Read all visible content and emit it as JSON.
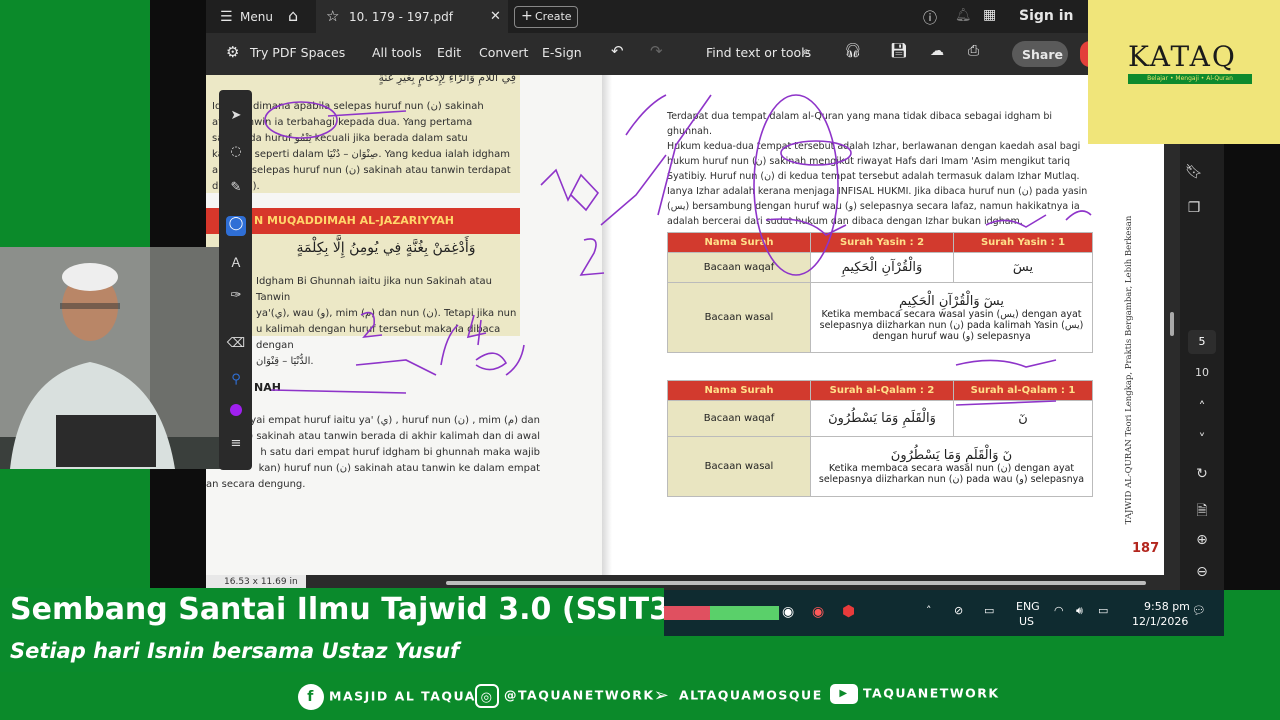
{
  "tabbar": {
    "menu_label": "Menu",
    "tab_title": "10. 179 - 197.pdf",
    "create_label": "Create",
    "sign_in_label": "Sign in"
  },
  "toolbar": {
    "spaces_label": "Try PDF Spaces",
    "all_tools": "All tools",
    "edit": "Edit",
    "convert": "Convert",
    "esign": "E-Sign",
    "search_label": "Find text or tools",
    "share_label": "Share"
  },
  "left_page": {
    "top_arabic": "فِي اللّامِ وَالرَّاءِ لِإِدْغَامٍ بِغَيْرِ غُنَّةٍ",
    "para1": [
      "Idgham dimana apabila selepas huruf nun (ن) sakinah",
      "atau tanwin ia terbahagi kepada dua. Yang pertama",
      "satu pada huruf يَنْمُو kecuali jika berada dalam satu",
      "kalimah seperti dalam صِنْوَان – دُنْيَا. Yang kedua ialah idgham",
      "apabila selepas huruf nun (ن) sakinah atau tanwin terdapat",
      "da ra' (ر)."
    ],
    "section_title": "N MUQADDIMAH AL-JAZARIYYAH",
    "arabic_verse": "وَأَدْغِمَنْ بِغُنَّةٍ فِي يُومِنُ   إِلَّا بِكِلْمَةٍ",
    "para2": [
      "Idgham Bi Ghunnah iaitu jika nun Sakinah atau Tanwin",
      "ya'(ي), wau (و), mim (م) dan nun (ن). Tetapi jika nun",
      "u kalimah dengan huruf tersebut maka ia dibaca dengan",
      "الدُّنْيَا – قِنْوَان."
    ],
    "heading": "NAH",
    "para3": [
      "yai empat huruf iaitu ya' (ي) , huruf nun (ن) , mim (م) dan",
      "(ن) sakinah atau tanwin berada di akhir kalimah dan di awal",
      "h satu dari empat huruf idgham bi ghunnah maka wajib",
      "kan) huruf nun (ن) sakinah atau tanwin ke dalam empat",
      "an secara dengung."
    ]
  },
  "right_page": {
    "para": [
      "Terdapat dua tempat dalam al-Quran yang mana tidak dibaca sebagai idgham bi ghunnah.",
      "Hukum kedua-dua tempat tersebut adalah Izhar, berlawanan dengan kaedah asal bagi",
      "hukum huruf nun (ن) sakinah mengikut riwayat Hafs dari Imam 'Asim mengikut tariq",
      "Syatibiy. Huruf nun (ن) di kedua tempat tersebut adalah termasuk dalam Izhar Mutlaq.",
      "Ianya Izhar adalah kerana menjaga INFISAL HUKMI. Jika dibaca huruf nun (ن) pada yasin",
      "(يس) bersambung dengan huruf wau (و) selepasnya secara lafaz, namun hakikatnya ia",
      "adalah bercerai dari sudut hukum dan dibaca dengan Izhar bukan idgham."
    ],
    "table1": {
      "headers": [
        "Nama Surah",
        "Surah Yasin : 2",
        "Surah Yasin : 1"
      ],
      "row1": {
        "label": "Bacaan waqaf",
        "c1": "وَالْقُرْآنِ الْحَكِيمِ",
        "c2": "يسٓ"
      },
      "row2": {
        "label": "Bacaan wasal",
        "arabic": "يسٓ وَالْقُرْآنِ الْحَكِيمِ",
        "text": "Ketika membaca secara wasal yasin (يس) dengan ayat selepasnya diizharkan nun (ن) pada kalimah Yasin (يس) dengan huruf wau (و) selepasnya"
      }
    },
    "table2": {
      "headers": [
        "Nama Surah",
        "Surah al-Qalam : 2",
        "Surah al-Qalam : 1"
      ],
      "row1": {
        "label": "Bacaan waqaf",
        "c1": "وَالْقَلَمِ وَمَا يَسْطُرُونَ",
        "c2": "نٓ"
      },
      "row2": {
        "label": "Bacaan wasal",
        "arabic": "نٓ وَالْقَلَمِ وَمَا يَسْطُرُونَ",
        "text": "Ketika membaca secara wasal nun (ن) dengan ayat selepasnya diizharkan nun (ن) pada wau (و) selepasnya"
      }
    },
    "side_title": "TAJWID AL-QURAN Teori Lengkap, Praktis Bergambar, Lebih Berkesan",
    "page_number": "187"
  },
  "page_size_label": "16.53 x 11.69 in",
  "side_nav": {
    "page_current": "5",
    "page_total": "10"
  },
  "logo": {
    "name": "KATAQ",
    "tagline": "Belajar • Mengaji • Al-Quran"
  },
  "taskbar": {
    "lang1": "ENG",
    "lang2": "US",
    "time": "9:58 pm",
    "date": "12/1/2026"
  },
  "banner": {
    "title": "Sembang Santai Ilmu Tajwid 3.0 (SSIT3)",
    "subtitle": "Setiap hari Isnin bersama Ustaz Yusuf"
  },
  "socials": {
    "facebook": "MASJID AL TAQUA",
    "instagram": "@TAQUANETWORK",
    "telegram": "ALTAQUAMOSQUE",
    "youtube": "TAQUANETWORK"
  },
  "colors": {
    "green_bg": "#0b8a2a",
    "table_header": "#d23a2e",
    "annotation_ink": "#8e34c9"
  }
}
